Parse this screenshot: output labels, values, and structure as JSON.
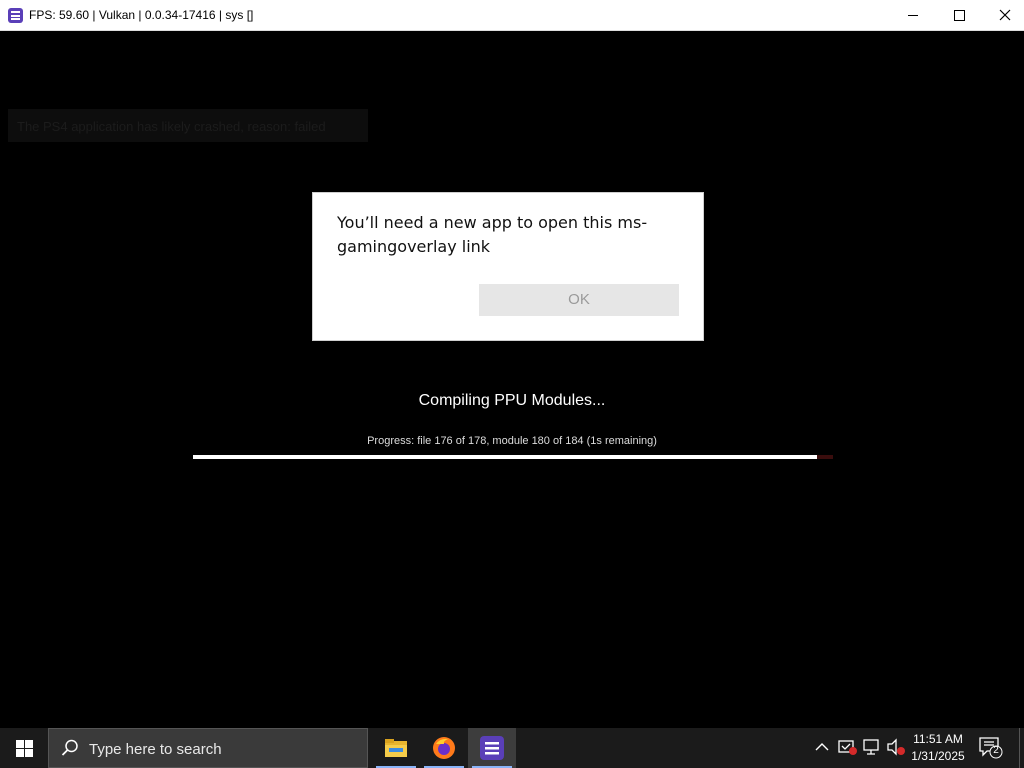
{
  "window": {
    "title": "FPS: 59.60 | Vulkan | 0.0.34-17416 | sys []",
    "minimize_label": "",
    "maximize_label": "",
    "close_label": ""
  },
  "hint": {
    "text": "The PS4 application has likely crashed, reason: failed"
  },
  "dialog": {
    "message": "You’ll need a new app to open this ms-gamingoverlay link",
    "ok_label": "OK"
  },
  "compile": {
    "title": "Compiling PPU Modules...",
    "progress_text": "Progress: file 176 of 178, module 180 of 184 (1s remaining)",
    "progress_fraction": 0.975
  },
  "taskbar": {
    "search_placeholder": "Type here to search",
    "apps": [
      "file-explorer-icon",
      "firefox-icon",
      "rpcs3-icon"
    ],
    "clock_time": "11:51 AM",
    "clock_date": "1/31/2025",
    "notification_count": "2"
  },
  "colors": {
    "app_accent": "#5a3fb8",
    "background": "#000000",
    "taskbar": "#1b1b1b",
    "progress_fill": "#ffffff",
    "progress_track": "#3a0d0d"
  }
}
